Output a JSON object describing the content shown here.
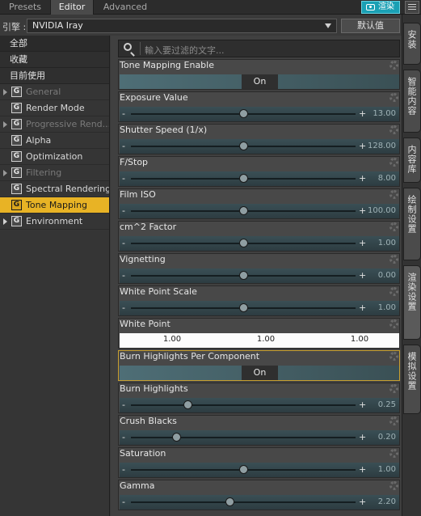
{
  "tabs": [
    "Presets",
    "Editor",
    "Advanced"
  ],
  "active_tab": "Editor",
  "render_button": "渲染",
  "engine": {
    "label": "引擎 :",
    "value": "NVIDIA Iray",
    "default_button": "默认值"
  },
  "categories": [
    "全部",
    "收藏",
    "目前使用"
  ],
  "nav": [
    {
      "label": "General",
      "expandable": true,
      "dim": true
    },
    {
      "label": "Render Mode",
      "expandable": false,
      "dim": false
    },
    {
      "label": "Progressive Rend...",
      "expandable": true,
      "dim": true
    },
    {
      "label": "Alpha",
      "expandable": false,
      "dim": false
    },
    {
      "label": "Optimization",
      "expandable": false,
      "dim": false
    },
    {
      "label": "Filtering",
      "expandable": true,
      "dim": true
    },
    {
      "label": "Spectral Rendering",
      "expandable": false,
      "dim": false
    },
    {
      "label": "Tone Mapping",
      "expandable": false,
      "dim": false,
      "active": true
    },
    {
      "label": "Environment",
      "expandable": true,
      "dim": false
    }
  ],
  "nav_icon_glyph": "G",
  "search_placeholder": "輸入要过滤的文字...",
  "properties": [
    {
      "name": "Tone Mapping Enable",
      "type": "toggle",
      "value": "On"
    },
    {
      "name": "Exposure Value",
      "type": "slider",
      "value": "13.00",
      "fraction": 0.5
    },
    {
      "name": "Shutter Speed (1/x)",
      "type": "slider",
      "value": "128.00",
      "fraction": 0.5
    },
    {
      "name": "F/Stop",
      "type": "slider",
      "value": "8.00",
      "fraction": 0.5
    },
    {
      "name": "Film ISO",
      "type": "slider",
      "value": "100.00",
      "fraction": 0.5
    },
    {
      "name": "cm^2 Factor",
      "type": "slider",
      "value": "1.00",
      "fraction": 0.5
    },
    {
      "name": "Vignetting",
      "type": "slider",
      "value": "0.00",
      "fraction": 0.5
    },
    {
      "name": "White Point Scale",
      "type": "slider",
      "value": "1.00",
      "fraction": 0.5
    },
    {
      "name": "White Point",
      "type": "color",
      "values": [
        "1.00",
        "1.00",
        "1.00"
      ]
    },
    {
      "name": "Burn Highlights Per Component",
      "type": "toggle",
      "value": "On",
      "highlight": true
    },
    {
      "name": "Burn Highlights",
      "type": "slider",
      "value": "0.25",
      "fraction": 0.25
    },
    {
      "name": "Crush Blacks",
      "type": "slider",
      "value": "0.20",
      "fraction": 0.2
    },
    {
      "name": "Saturation",
      "type": "slider",
      "value": "1.00",
      "fraction": 0.5
    },
    {
      "name": "Gamma",
      "type": "slider",
      "value": "2.20",
      "fraction": 0.44
    }
  ],
  "side_tabs": [
    "安装",
    "智能内容",
    "内容库",
    "绘制设置",
    "渲染设置",
    "模拟设置"
  ],
  "active_side_tab": "渲染设置"
}
